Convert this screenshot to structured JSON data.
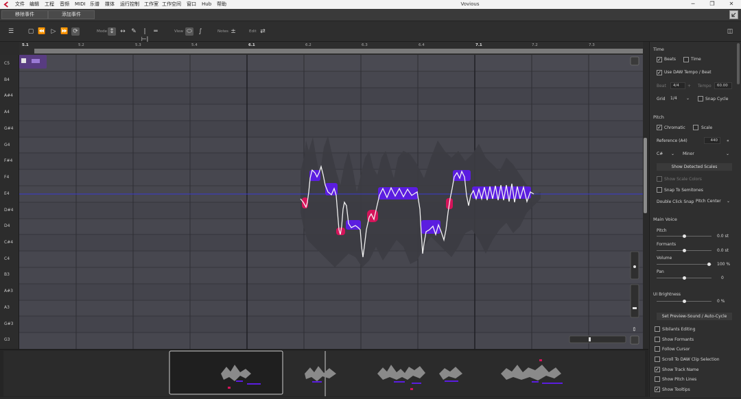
{
  "menubar": {
    "items": [
      "文件",
      "编辑",
      "工程",
      "音频",
      "MIDI",
      "乐谱",
      "媒体",
      "运行控制",
      "工作室",
      "工作空间",
      "窗口",
      "Hub",
      "帮助"
    ],
    "window_title": "Vovious"
  },
  "eventbar": {
    "remove_event": "移除事件",
    "add_event": "添加事件"
  },
  "toolbar": {
    "mode_label": "Mode",
    "view_label": "View",
    "notes_label": "Notes",
    "edit_label": "Edit"
  },
  "ruler": {
    "labels": [
      "5.1",
      "5.2",
      "5.3",
      "5.4",
      "6.1",
      "6.2",
      "6.3",
      "6.4",
      "7.1",
      "7.2",
      "7.3"
    ]
  },
  "keys": [
    "C5",
    "B4",
    "A#4",
    "A4",
    "G#4",
    "G4",
    "F#4",
    "F4",
    "E4",
    "D#4",
    "D4",
    "C#4",
    "C4",
    "B3",
    "A#3",
    "A3",
    "G#3",
    "G3"
  ],
  "panel": {
    "time": {
      "title": "Time",
      "beats": "Beats",
      "time": "Time",
      "use_daw_tempo": "Use DAW Tempo / Beat",
      "beat_label": "Beat",
      "beat_value": "4/4",
      "tempo_label": "Tempo",
      "tempo_value": "60.00",
      "grid_label": "Grid",
      "grid_value": "1/4",
      "snap_cycle": "Snap Cycle"
    },
    "pitch": {
      "title": "Pitch",
      "chromatic": "Chromatic",
      "scale": "Scale",
      "reference_label": "Reference (A4)",
      "reference_value": "440",
      "key_value": "C#",
      "mode_value": "Minor",
      "show_detected_scales": "Show Detected Scales",
      "show_scale_colors": "Show Scale Colors",
      "snap_to_semitones": "Snap To Semitones",
      "double_click_snap_label": "Double Click Snap",
      "double_click_snap_value": "Pitch Center"
    },
    "main_voice": {
      "title": "Main Voice",
      "pitch_label": "Pitch",
      "pitch_value": "0.0 st",
      "pitch_level": 0.5,
      "formants_label": "Formants",
      "formants_value": "0.0 st",
      "formants_level": 0.5,
      "volume_label": "Volume",
      "volume_value": "100 %",
      "volume_level": 0.95,
      "pan_label": "Pan",
      "pan_value": "0",
      "pan_level": 0.5
    },
    "ui_brightness": {
      "label": "UI Brightness",
      "value": "0 %",
      "level": 0.5
    },
    "set_preview_sound": "Set Preview-Sound / Auto-Cycle",
    "options": [
      {
        "label": "Sibilants Editing",
        "checked": false
      },
      {
        "label": "Show Formants",
        "checked": false
      },
      {
        "label": "Follow Cursor",
        "checked": false
      },
      {
        "label": "Scroll To DAW Clip Selection",
        "checked": false
      },
      {
        "label": "Show Track Name",
        "checked": true
      },
      {
        "label": "Show Pitch Lines",
        "checked": false
      },
      {
        "label": "Show Tooltips",
        "checked": true
      }
    ]
  },
  "colors": {
    "note_blue": "#5b1de0",
    "note_pink": "#d4145a",
    "editor_bg": "#47474f",
    "center_line": "#3a3ad0"
  }
}
